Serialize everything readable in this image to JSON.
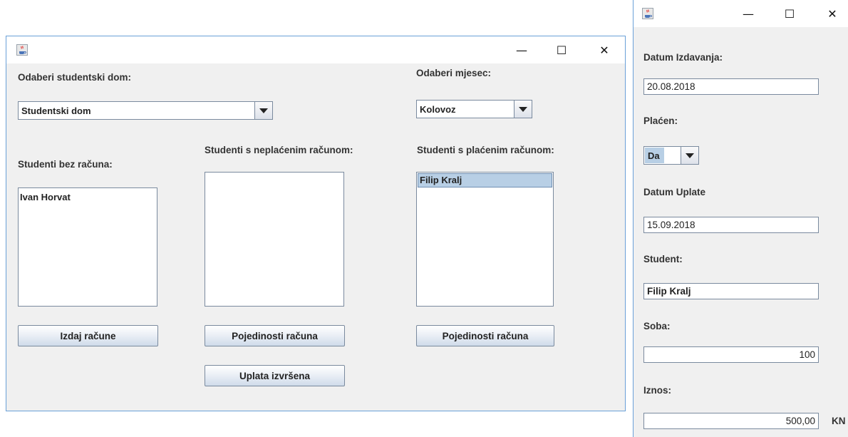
{
  "main_window": {
    "controls": {
      "minimize": "—",
      "maximize": "☐",
      "close": "✕"
    },
    "dorm_label": "Odaberi studentski dom:",
    "dorm_selected": "Studentski dom",
    "month_label": "Odaberi mjesec:",
    "month_selected": "Kolovoz",
    "no_invoice": {
      "label": "Studenti bez računa:",
      "items": [
        "Ivan Horvat"
      ],
      "button": "Izdaj račune"
    },
    "unpaid": {
      "label": "Studenti s neplaćenim računom:",
      "items": [],
      "button_details": "Pojedinosti računa",
      "button_paid": "Uplata izvršena"
    },
    "paid": {
      "label": "Studenti s plaćenim računom:",
      "items": [
        "Filip Kralj"
      ],
      "button": "Pojedinosti računa"
    }
  },
  "detail_window": {
    "controls": {
      "minimize": "—",
      "maximize": "☐",
      "close": "✕"
    },
    "issue_date_label": "Datum Izdavanja:",
    "issue_date": "20.08.2018",
    "paid_label": "Plaćen:",
    "paid_value": "Da",
    "payment_date_label": "Datum Uplate",
    "payment_date": "15.09.2018",
    "student_label": "Student:",
    "student_value": "Filip Kralj",
    "room_label": "Soba:",
    "room_value": "100",
    "amount_label": "Iznos:",
    "amount_value": "500,00",
    "currency": "KN"
  },
  "icons": {
    "app": "java-coffee-cup-icon",
    "dropdown": "chevron-down-icon"
  }
}
